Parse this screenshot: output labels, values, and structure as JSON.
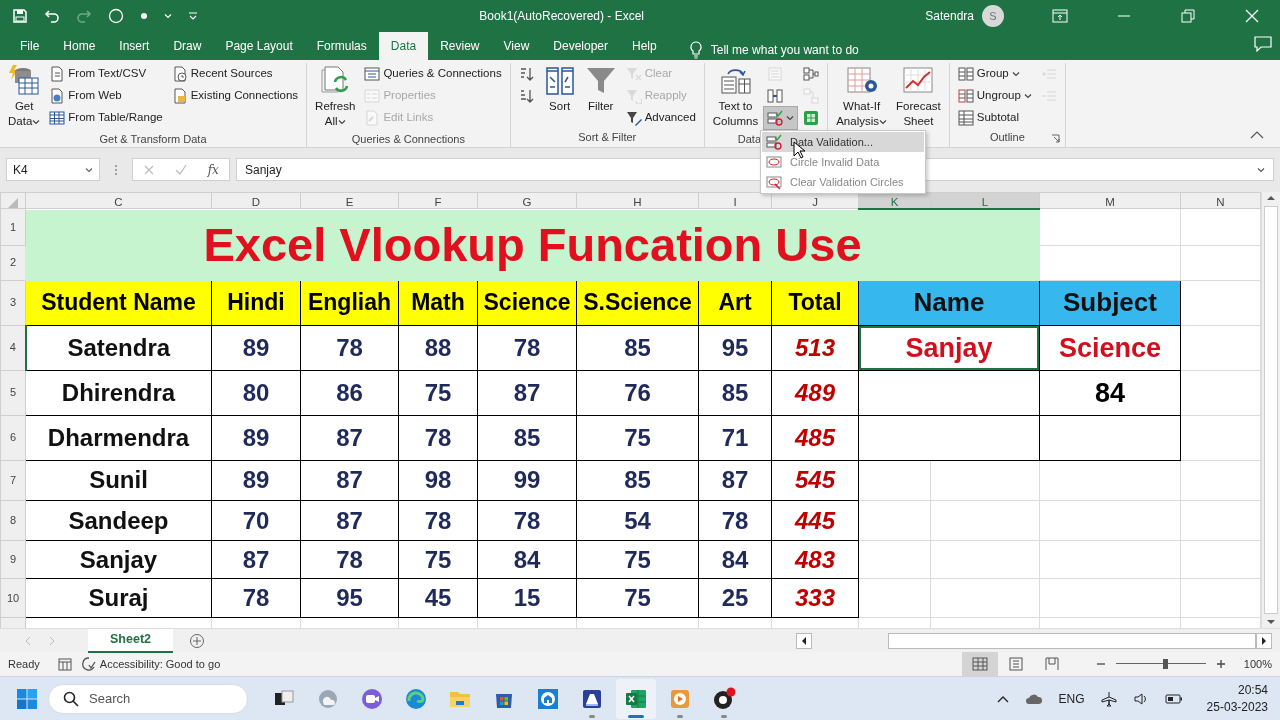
{
  "window": {
    "title": "Book1(AutoRecovered)  -  Excel",
    "user": "Satendra",
    "avatar": "S"
  },
  "tabs": [
    {
      "label": "File",
      "selected": false
    },
    {
      "label": "Home",
      "selected": false
    },
    {
      "label": "Insert",
      "selected": false
    },
    {
      "label": "Draw",
      "selected": false
    },
    {
      "label": "Page Layout",
      "selected": false
    },
    {
      "label": "Formulas",
      "selected": false
    },
    {
      "label": "Data",
      "selected": true
    },
    {
      "label": "Review",
      "selected": false
    },
    {
      "label": "View",
      "selected": false
    },
    {
      "label": "Developer",
      "selected": false
    },
    {
      "label": "Help",
      "selected": false
    }
  ],
  "tell_me": "Tell me what you want to do",
  "ribbon": {
    "groups": [
      {
        "label": "Get & Transform Data",
        "items": [
          {
            "kind": "large",
            "lines": [
              "Get",
              "Data"
            ],
            "dropdown": true,
            "disabled": false
          },
          {
            "kind": "stack",
            "items": [
              {
                "label": "From Text/CSV",
                "dropdown": false,
                "disabled": false
              },
              {
                "label": "From Web",
                "dropdown": false,
                "disabled": false
              },
              {
                "label": "From Table/Range",
                "dropdown": false,
                "disabled": false
              }
            ]
          },
          {
            "kind": "stack",
            "items": [
              {
                "label": "Recent Sources",
                "dropdown": false,
                "disabled": false
              },
              {
                "label": "Existing Connections",
                "dropdown": false,
                "disabled": false
              }
            ]
          }
        ]
      },
      {
        "label": "Queries & Connections",
        "items": [
          {
            "kind": "large",
            "lines": [
              "Refresh",
              "All"
            ],
            "dropdown": true,
            "disabled": false
          },
          {
            "kind": "stack",
            "items": [
              {
                "label": "Queries & Connections",
                "dropdown": false,
                "disabled": false
              },
              {
                "label": "Properties",
                "dropdown": false,
                "disabled": true
              },
              {
                "label": "Edit Links",
                "dropdown": false,
                "disabled": true
              }
            ]
          }
        ]
      },
      {
        "label": "Sort & Filter",
        "items": [
          {
            "kind": "stack",
            "items": [
              {
                "dropdown": false,
                "disabled": false
              },
              {
                "dropdown": false,
                "disabled": false
              }
            ]
          },
          {
            "kind": "large",
            "lines": [
              "Sort"
            ],
            "dropdown": false,
            "disabled": false
          },
          {
            "kind": "large",
            "lines": [
              "Filter"
            ],
            "dropdown": false,
            "disabled": false
          },
          {
            "kind": "stack",
            "items": [
              {
                "label": "Clear",
                "dropdown": false,
                "disabled": true
              },
              {
                "label": "Reapply",
                "dropdown": false,
                "disabled": true
              },
              {
                "label": "Advanced",
                "dropdown": false,
                "disabled": false
              }
            ]
          }
        ]
      },
      {
        "label": "Data",
        "items": [
          {
            "kind": "large",
            "lines": [
              "Text to",
              "Columns"
            ],
            "dropdown": false,
            "disabled": false
          },
          {
            "kind": "stack",
            "items": [
              {
                "dropdown": false,
                "disabled": true,
                "pressed": false
              },
              {
                "dropdown": false,
                "disabled": false,
                "pressed": false
              },
              {
                "dropdown": true,
                "disabled": false,
                "pressed": true
              }
            ]
          },
          {
            "kind": "stack",
            "items": [
              {
                "dropdown": false,
                "disabled": false
              },
              {
                "dropdown": false,
                "disabled": true
              },
              {
                "dropdown": false,
                "disabled": false
              }
            ]
          }
        ]
      },
      {
        "items": [
          {
            "kind": "large",
            "lines": [
              "What-If",
              "Analysis"
            ],
            "dropdown": true,
            "disabled": false
          },
          {
            "kind": "large",
            "lines": [
              "Forecast",
              "Sheet"
            ],
            "dropdown": false,
            "disabled": false
          }
        ]
      },
      {
        "label": "Outline",
        "launcher": true,
        "items": [
          {
            "kind": "stack",
            "items": [
              {
                "label": "Group",
                "dropdown": true,
                "disabled": false
              },
              {
                "label": "Ungroup",
                "dropdown": true,
                "disabled": false
              },
              {
                "label": "Subtotal",
                "dropdown": false,
                "disabled": false
              }
            ]
          },
          {
            "kind": "stack",
            "items": [
              {
                "dropdown": false,
                "disabled": true
              },
              {
                "dropdown": false,
                "disabled": true
              }
            ]
          }
        ]
      }
    ]
  },
  "menu": {
    "items": [
      {
        "label": "Data Validation...",
        "selected": true
      },
      {
        "label": "Circle Invalid Data",
        "selected": false
      },
      {
        "label": "Clear Validation Circles",
        "selected": false
      }
    ]
  },
  "formula_bar": {
    "name_box": "K4",
    "function_label": "fx",
    "formula": "Sanjay"
  },
  "sheet": {
    "columns": [
      {
        "label": "C",
        "selected": false
      },
      {
        "label": "D",
        "selected": false
      },
      {
        "label": "E",
        "selected": false
      },
      {
        "label": "F",
        "selected": false
      },
      {
        "label": "G",
        "selected": false
      },
      {
        "label": "H",
        "selected": false
      },
      {
        "label": "I",
        "selected": false
      },
      {
        "label": "J",
        "selected": false
      },
      {
        "label": "K",
        "selected": true
      },
      {
        "label": "L",
        "selected": true
      },
      {
        "label": "M",
        "selected": false
      },
      {
        "label": "N",
        "selected": false
      }
    ],
    "rows": [
      {
        "label": "1",
        "selected": false
      },
      {
        "label": "2",
        "selected": false
      },
      {
        "label": "3",
        "selected": false
      },
      {
        "label": "4",
        "selected": true
      },
      {
        "label": "5",
        "selected": false
      },
      {
        "label": "6",
        "selected": false
      },
      {
        "label": "7",
        "selected": false
      },
      {
        "label": "8",
        "selected": false
      },
      {
        "label": "9",
        "selected": false
      },
      {
        "label": "10",
        "selected": false
      }
    ],
    "title": "Excel Vlookup Funcation Use",
    "headers": [
      "Student Name",
      "Hindi",
      "Engliah",
      "Math",
      "Science",
      "S.Science",
      "Art",
      "Total"
    ],
    "students": [
      {
        "name": "Satendra",
        "scores": [
          "89",
          "78",
          "88",
          "78",
          "85",
          "95"
        ],
        "total": "513"
      },
      {
        "name": "Dhirendra",
        "scores": [
          "80",
          "86",
          "75",
          "87",
          "76",
          "85"
        ],
        "total": "489"
      },
      {
        "name": "Dharmendra",
        "scores": [
          "89",
          "87",
          "78",
          "85",
          "75",
          "71"
        ],
        "total": "485"
      },
      {
        "name": "Sunil",
        "scores": [
          "89",
          "87",
          "98",
          "99",
          "85",
          "87"
        ],
        "total": "545"
      },
      {
        "name": "Sandeep",
        "scores": [
          "70",
          "87",
          "78",
          "78",
          "54",
          "78"
        ],
        "total": "445"
      },
      {
        "name": "Sanjay",
        "scores": [
          "87",
          "78",
          "75",
          "84",
          "75",
          "84"
        ],
        "total": "483"
      },
      {
        "name": "Suraj",
        "scores": [
          "78",
          "95",
          "45",
          "15",
          "75",
          "25"
        ],
        "total": "333"
      }
    ],
    "lookup": {
      "headers": [
        "Name",
        "Subject"
      ],
      "name": {
        "value": "Sanjay",
        "selected": true
      },
      "subject": "Science",
      "result": "84"
    }
  },
  "sheet_tabs": [
    {
      "label": "Sheet2",
      "selected": true
    }
  ],
  "status_bar": {
    "mode": "Ready",
    "accessibility": "Accessibility: Good to go",
    "views": [
      {
        "selected": true
      },
      {
        "selected": false
      },
      {
        "selected": false
      }
    ],
    "zoom": {
      "level": 0.55,
      "reading": "100%"
    }
  },
  "taskbar": {
    "search": {
      "placeholder": "Search"
    },
    "apps": [
      {
        "running": false,
        "active": false
      },
      {
        "running": false,
        "active": false
      },
      {
        "running": false,
        "active": false
      },
      {
        "running": false,
        "active": false
      },
      {
        "running": false,
        "active": false
      },
      {
        "running": false,
        "active": false
      },
      {
        "running": false,
        "active": false
      },
      {
        "running": true,
        "active": false
      },
      {
        "running": true,
        "active": true
      },
      {
        "running": true,
        "active": false
      },
      {
        "running": true,
        "active": false
      }
    ],
    "language": "ENG",
    "time": "20:54",
    "date": "25-03-2023"
  }
}
